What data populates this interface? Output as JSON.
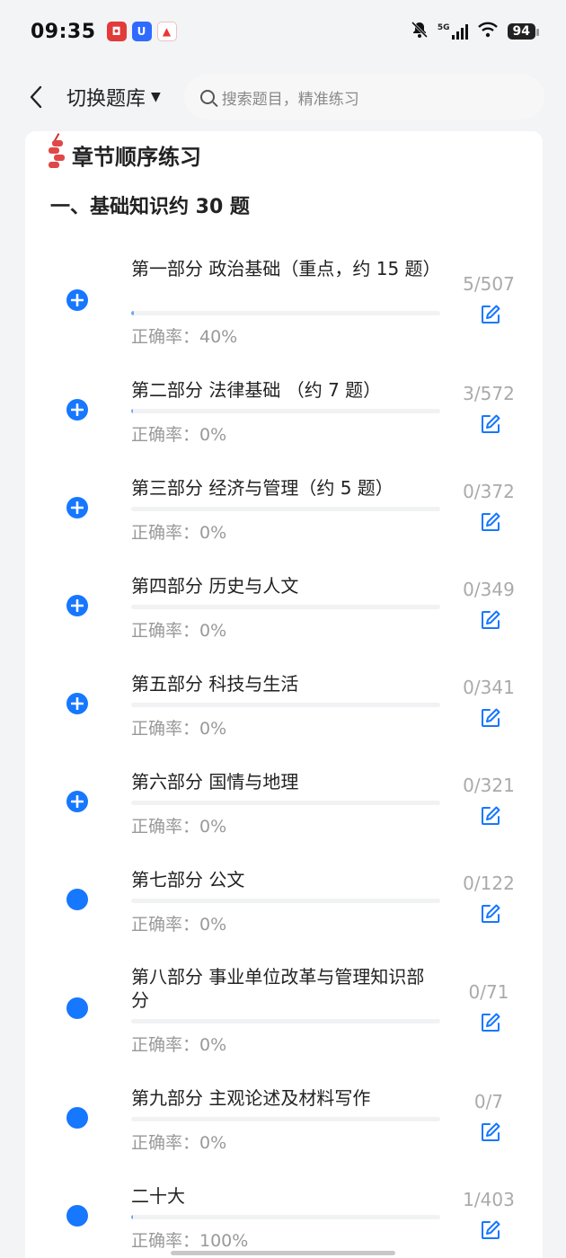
{
  "status_bar": {
    "time": "09:35",
    "network": "5G",
    "battery": "94",
    "icons": [
      "bell-off-icon",
      "signal-icon",
      "wifi-icon",
      "battery-icon"
    ]
  },
  "header": {
    "back_icon": "chevron-left-icon",
    "switch_label": "切换题库",
    "search_placeholder": "搜索题目，精准练习"
  },
  "section": {
    "title": "章节顺序练习",
    "chapter_heading": "一、基础知识约 30 题"
  },
  "chapters": [
    {
      "title": "第一部分 政治基础（重点，约 15 题）",
      "rate": "正确率：40%",
      "count": "5/507",
      "progress": 0.0099,
      "icon": "plus"
    },
    {
      "title": "第二部分 法律基础 （约 7 题）",
      "rate": "正确率：0%",
      "count": "3/572",
      "progress": 0.0052,
      "icon": "plus"
    },
    {
      "title": "第三部分 经济与管理（约 5 题）",
      "rate": "正确率：0%",
      "count": "0/372",
      "progress": 0,
      "icon": "plus"
    },
    {
      "title": "第四部分 历史与人文",
      "rate": "正确率：0%",
      "count": "0/349",
      "progress": 0,
      "icon": "plus"
    },
    {
      "title": "第五部分 科技与生活",
      "rate": "正确率：0%",
      "count": "0/341",
      "progress": 0,
      "icon": "plus"
    },
    {
      "title": "第六部分 国情与地理",
      "rate": "正确率：0%",
      "count": "0/321",
      "progress": 0,
      "icon": "plus"
    },
    {
      "title": "第七部分 公文",
      "rate": "正确率：0%",
      "count": "0/122",
      "progress": 0,
      "icon": "dot"
    },
    {
      "title": "第八部分 事业单位改革与管理知识部分",
      "rate": "正确率：0%",
      "count": "0/71",
      "progress": 0,
      "icon": "dot"
    },
    {
      "title": "第九部分 主观论述及材料写作",
      "rate": "正确率：0%",
      "count": "0/7",
      "progress": 0,
      "icon": "dot"
    },
    {
      "title": "二十大",
      "rate": "正确率：100%",
      "count": "1/403",
      "progress": 0.0025,
      "icon": "dot"
    }
  ],
  "colors": {
    "accent": "#1677ff",
    "progress_fill": "#6fa6f5"
  }
}
